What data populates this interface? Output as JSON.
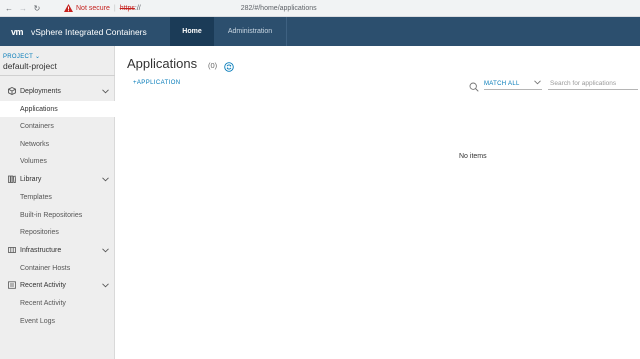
{
  "browser": {
    "not_secure": "Not secure",
    "url_scheme": "https",
    "url_scheme_rest": "://",
    "url_path": "282/#/home/applications"
  },
  "header": {
    "logo": "vm",
    "title": "vSphere Integrated Containers",
    "tabs": [
      {
        "label": "Home"
      },
      {
        "label": "Administration"
      }
    ]
  },
  "sidebar": {
    "project_label": "PROJECT",
    "project_name": "default-project",
    "groups": [
      {
        "label": "Deployments",
        "icon": "deployments-icon",
        "items": [
          {
            "label": "Applications"
          },
          {
            "label": "Containers"
          },
          {
            "label": "Networks"
          },
          {
            "label": "Volumes"
          }
        ]
      },
      {
        "label": "Library",
        "icon": "library-icon",
        "items": [
          {
            "label": "Templates"
          },
          {
            "label": "Built-in Repositories"
          },
          {
            "label": "Repositories"
          }
        ]
      },
      {
        "label": "Infrastructure",
        "icon": "infrastructure-icon",
        "items": [
          {
            "label": "Container Hosts"
          }
        ]
      },
      {
        "label": "Recent Activity",
        "icon": "activity-icon",
        "items": [
          {
            "label": "Recent Activity"
          },
          {
            "label": "Event Logs"
          }
        ]
      }
    ]
  },
  "main": {
    "title": "Applications",
    "count": "(0)",
    "add_button": "+APPLICATION",
    "match_all": "MATCH ALL",
    "search_placeholder": "Search for applications",
    "empty_text": "No items"
  },
  "colors": {
    "header_bg": "#2c4f6e",
    "active_tab_bg": "#1b3b57",
    "accent": "#0079b8",
    "sidebar_bg": "#eeeeee",
    "warning": "#c5221f"
  }
}
